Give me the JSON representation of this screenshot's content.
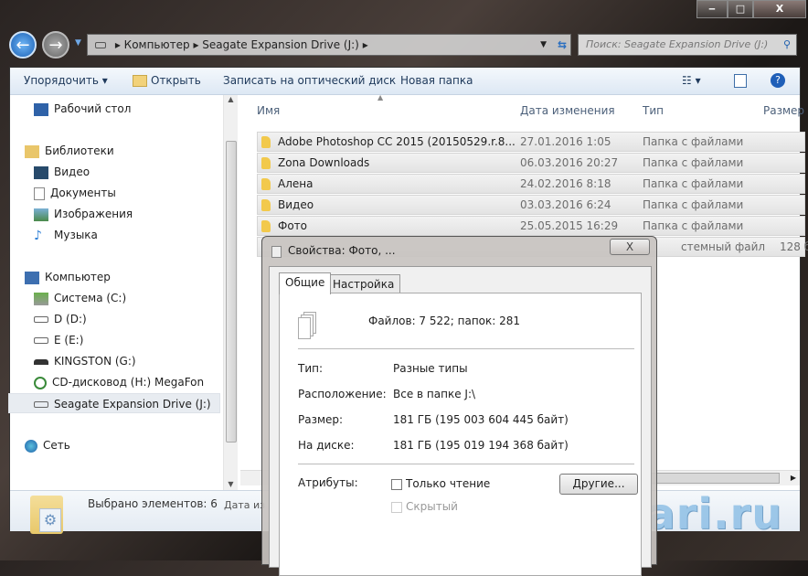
{
  "window": {
    "min": "‒",
    "max": "□",
    "close": "X"
  },
  "address": {
    "crumbs": [
      "Компьютер",
      "Seagate Expansion Drive (J:)"
    ],
    "search_placeholder": "Поиск: Seagate Expansion Drive (J:)"
  },
  "toolbar": {
    "organize": "Упорядочить ▾",
    "open": "Открыть",
    "burn": "Записать на оптический диск",
    "new_folder": "Новая папка"
  },
  "nav": [
    "Рабочий стол",
    "Библиотеки",
    "Видео",
    "Документы",
    "Изображения",
    "Музыка",
    "Компьютер",
    "Система (C:)",
    "D (D:)",
    "E (E:)",
    "KINGSTON (G:)",
    "CD-дисковод (H:) MegaFon",
    "Seagate Expansion Drive (J:)",
    "Сеть"
  ],
  "columns": {
    "name": "Имя",
    "date": "Дата изменения",
    "type": "Тип",
    "size": "Размер"
  },
  "rows": [
    {
      "name": "Adobe Photoshop CC 2015 (20150529.r.8...",
      "date": "27.01.2016 1:05",
      "type": "Папка с файлами"
    },
    {
      "name": "Zona Downloads",
      "date": "06.03.2016 20:27",
      "type": "Папка с файлами"
    },
    {
      "name": "Алена",
      "date": "24.02.2016 8:18",
      "type": "Папка с файлами"
    },
    {
      "name": "Видео",
      "date": "03.03.2016 6:24",
      "type": "Папка с файлами"
    },
    {
      "name": "Фото",
      "date": "25.05.2015 16:29",
      "type": "Папка с файлами"
    },
    {
      "type": "стемный файл",
      "size": "128 б"
    }
  ],
  "status": {
    "selected": "Выбрано элементов: 6",
    "date_label": "Дата из"
  },
  "dialog": {
    "title": "Свойства: Фото, ...",
    "tabs": [
      "Общие",
      "Настройка"
    ],
    "summary": "Файлов: 7 522; папок: 281",
    "fields": [
      {
        "label": "Тип:",
        "value": "Разные типы"
      },
      {
        "label": "Расположение:",
        "value": "Все в папке J:\\"
      },
      {
        "label": "Размер:",
        "value": "181 ГБ (195 003 604 445 байт)"
      },
      {
        "label": "На диске:",
        "value": "181 ГБ (195 019 194 368 байт)"
      }
    ],
    "attributes": "Атрибуты:",
    "readonly": "Только чтение",
    "hidden": "Скрытый",
    "other": "Другие...",
    "close": "X"
  },
  "watermark": "tehnari.ru"
}
